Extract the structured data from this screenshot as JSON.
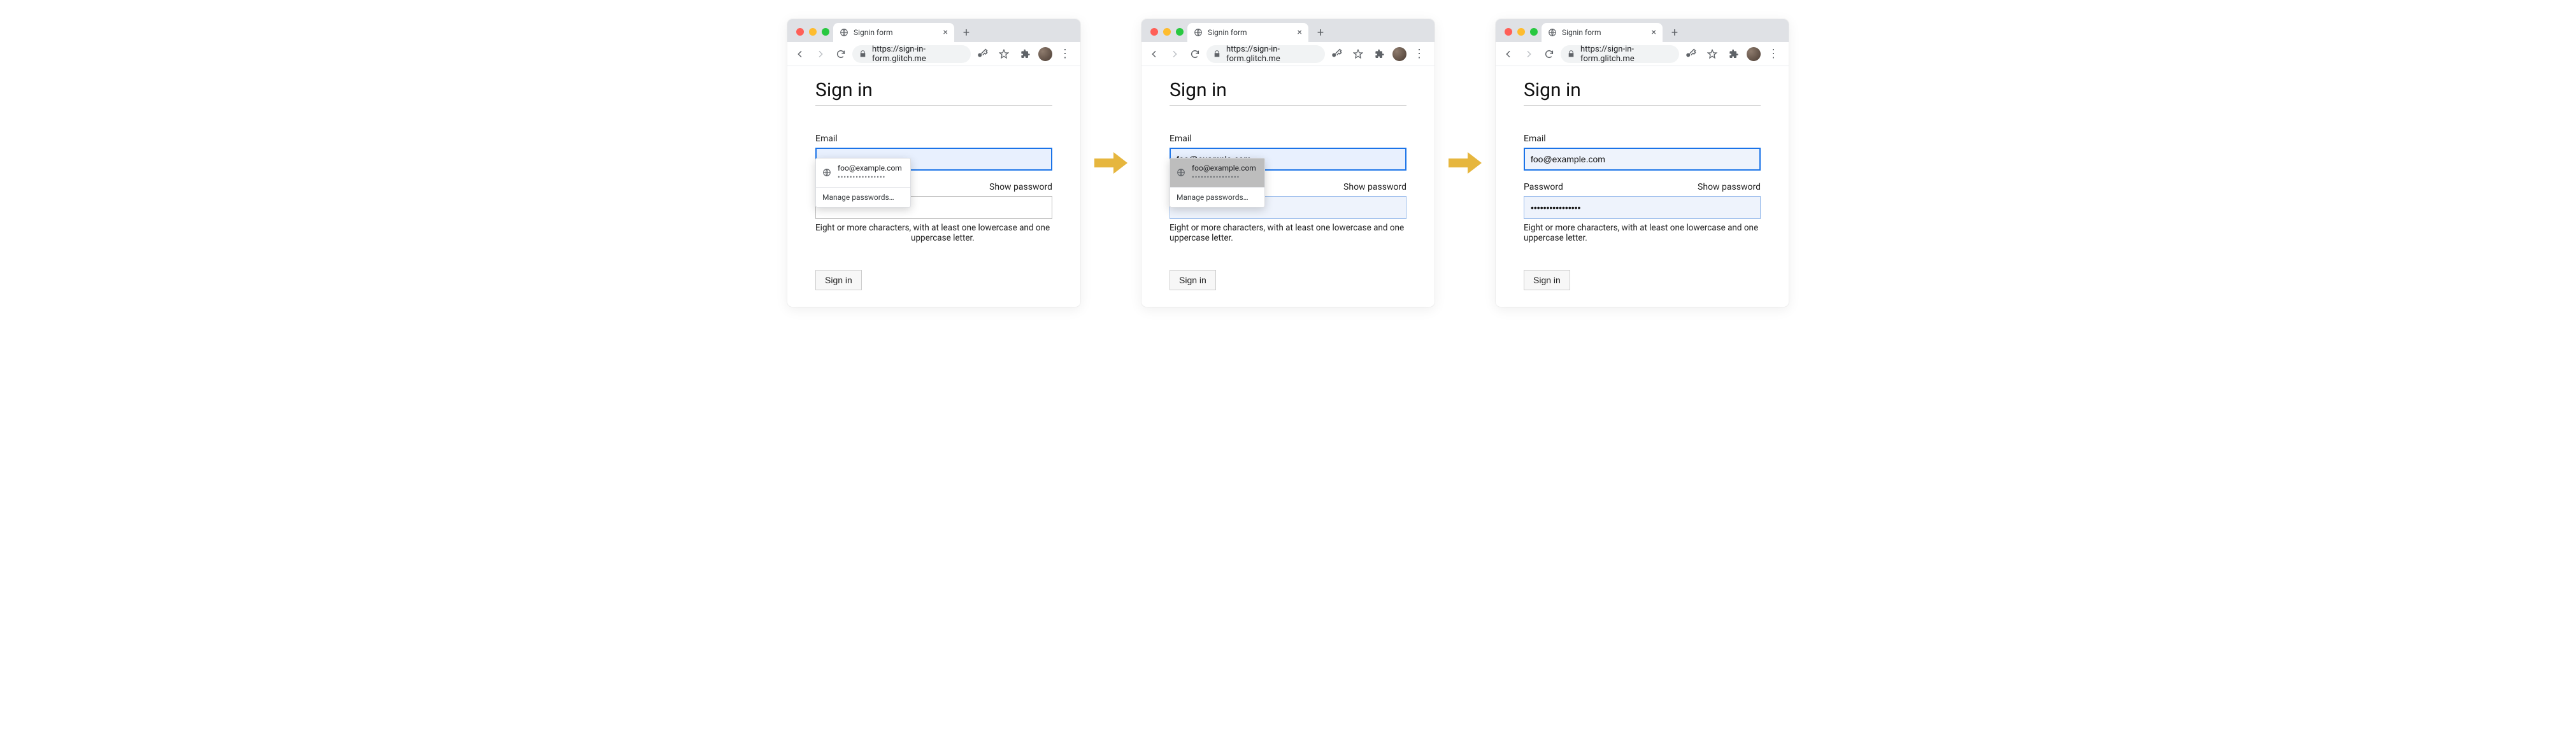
{
  "browser": {
    "tab_title": "Signin form",
    "url": "https://sign-in-form.glitch.me",
    "new_tab_glyph": "+",
    "close_glyph": "×",
    "menu_glyph": "⋮"
  },
  "page": {
    "heading": "Sign in",
    "email_label": "Email",
    "password_label": "Password",
    "show_password": "Show password",
    "hint": "Eight or more characters, with at least one lowercase and one uppercase letter.",
    "submit": "Sign in"
  },
  "autofill": {
    "email": "foo@example.com",
    "password_mask": "••••••••••••••••",
    "manage": "Manage passwords…"
  },
  "states": {
    "s1": {
      "email_value": "",
      "password_value": ""
    },
    "s2": {
      "email_value": "foo@example.com",
      "password_value": ""
    },
    "s3": {
      "email_value": "foo@example.com",
      "password_value": "••••••••••••••••"
    }
  }
}
